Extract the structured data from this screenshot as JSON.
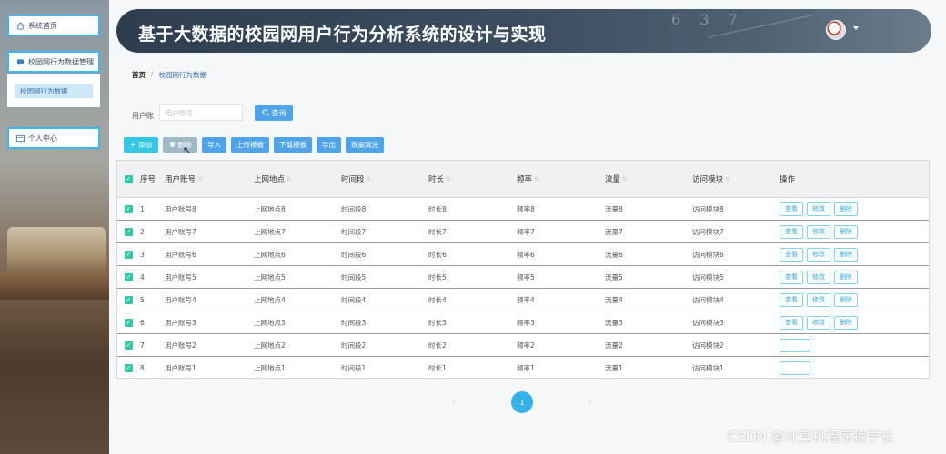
{
  "sidebar": {
    "home_label": "系统首页",
    "data_label": "校园网行为数据管理",
    "sub_label": "校园网行为数据",
    "personal_label": "个人中心"
  },
  "header": {
    "title": "基于大数据的校园网用户行为分析系统的设计与实现",
    "decor": "6 3 7"
  },
  "breadcrumb": {
    "home": "首页",
    "sep": "/",
    "current": "校园网行为数据"
  },
  "search": {
    "label": "用户账",
    "placeholder": "用户账号",
    "button": "查询"
  },
  "toolbar": {
    "add": "添加",
    "delete": "删除",
    "import": "导入",
    "upload_template": "上传模板",
    "download_template": "下载模板",
    "export": "导出",
    "clean": "数据清洗"
  },
  "table": {
    "columns": [
      "序号",
      "用户账号",
      "上网地点",
      "时间段",
      "时长",
      "频率",
      "流量",
      "访问模块",
      "操作"
    ],
    "actions": [
      "查看",
      "修改",
      "删除"
    ],
    "rows": [
      [
        "1",
        "用户账号8",
        "上网地点8",
        "时间段8",
        "时长8",
        "频率8",
        "流量8",
        "访问模块8"
      ],
      [
        "2",
        "用户账号7",
        "上网地点7",
        "时间段7",
        "时长7",
        "频率7",
        "流量7",
        "访问模块7"
      ],
      [
        "3",
        "用户账号6",
        "上网地点6",
        "时间段6",
        "时长6",
        "频率6",
        "流量6",
        "访问模块6"
      ],
      [
        "4",
        "用户账号5",
        "上网地点5",
        "时间段5",
        "时长5",
        "频率5",
        "流量5",
        "访问模块5"
      ],
      [
        "5",
        "用户账号4",
        "上网地点4",
        "时间段4",
        "时长4",
        "频率4",
        "流量4",
        "访问模块4"
      ],
      [
        "6",
        "用户账号3",
        "上网地点3",
        "时间段3",
        "时长3",
        "频率3",
        "流量3",
        "访问模块3"
      ],
      [
        "7",
        "用户账号2",
        "上网地点2",
        "时间段2",
        "时长2",
        "频率2",
        "流量2",
        "访问模块2"
      ],
      [
        "8",
        "用户账号1",
        "上网地点1",
        "时间段1",
        "时长1",
        "频率1",
        "流量1",
        "访问模块1"
      ]
    ]
  },
  "pagination": {
    "prev": "‹",
    "current": "1",
    "next": "›"
  },
  "watermark": "CSDN @计算机程序猿学长",
  "colors": {
    "accent": "#33b2e8",
    "primary_button": "#4fa3e8",
    "header_bg": "#2e3e4f",
    "checkbox": "#33c7a8"
  }
}
